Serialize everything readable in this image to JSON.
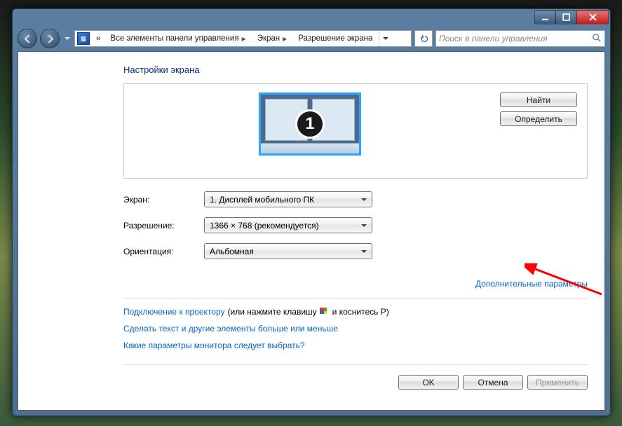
{
  "breadcrumb": {
    "prefix": "«",
    "items": [
      "Все элементы панели управления",
      "Экран",
      "Разрешение экрана"
    ]
  },
  "search": {
    "placeholder": "Поиск в панели управления"
  },
  "page": {
    "title": "Настройки экрана"
  },
  "monitor_box": {
    "selected_number": "1",
    "find_button": "Найти",
    "identify_button": "Определить"
  },
  "form": {
    "display_label": "Экран:",
    "display_value": "1. Дисплей мобильного ПК",
    "resolution_label": "Разрешение:",
    "resolution_value": "1366 × 768 (рекомендуется)",
    "orientation_label": "Ориентация:",
    "orientation_value": "Альбомная"
  },
  "links": {
    "advanced": "Дополнительные параметры",
    "projector_link": "Подключение к проектору",
    "projector_suffix_a": " (или нажмите клавишу ",
    "projector_suffix_b": " и коснитесь P)",
    "text_size": "Сделать текст и другие элементы больше или меньше",
    "which_settings": "Какие параметры монитора следует выбрать?"
  },
  "footer": {
    "ok": "OK",
    "cancel": "Отмена",
    "apply": "Применить"
  }
}
